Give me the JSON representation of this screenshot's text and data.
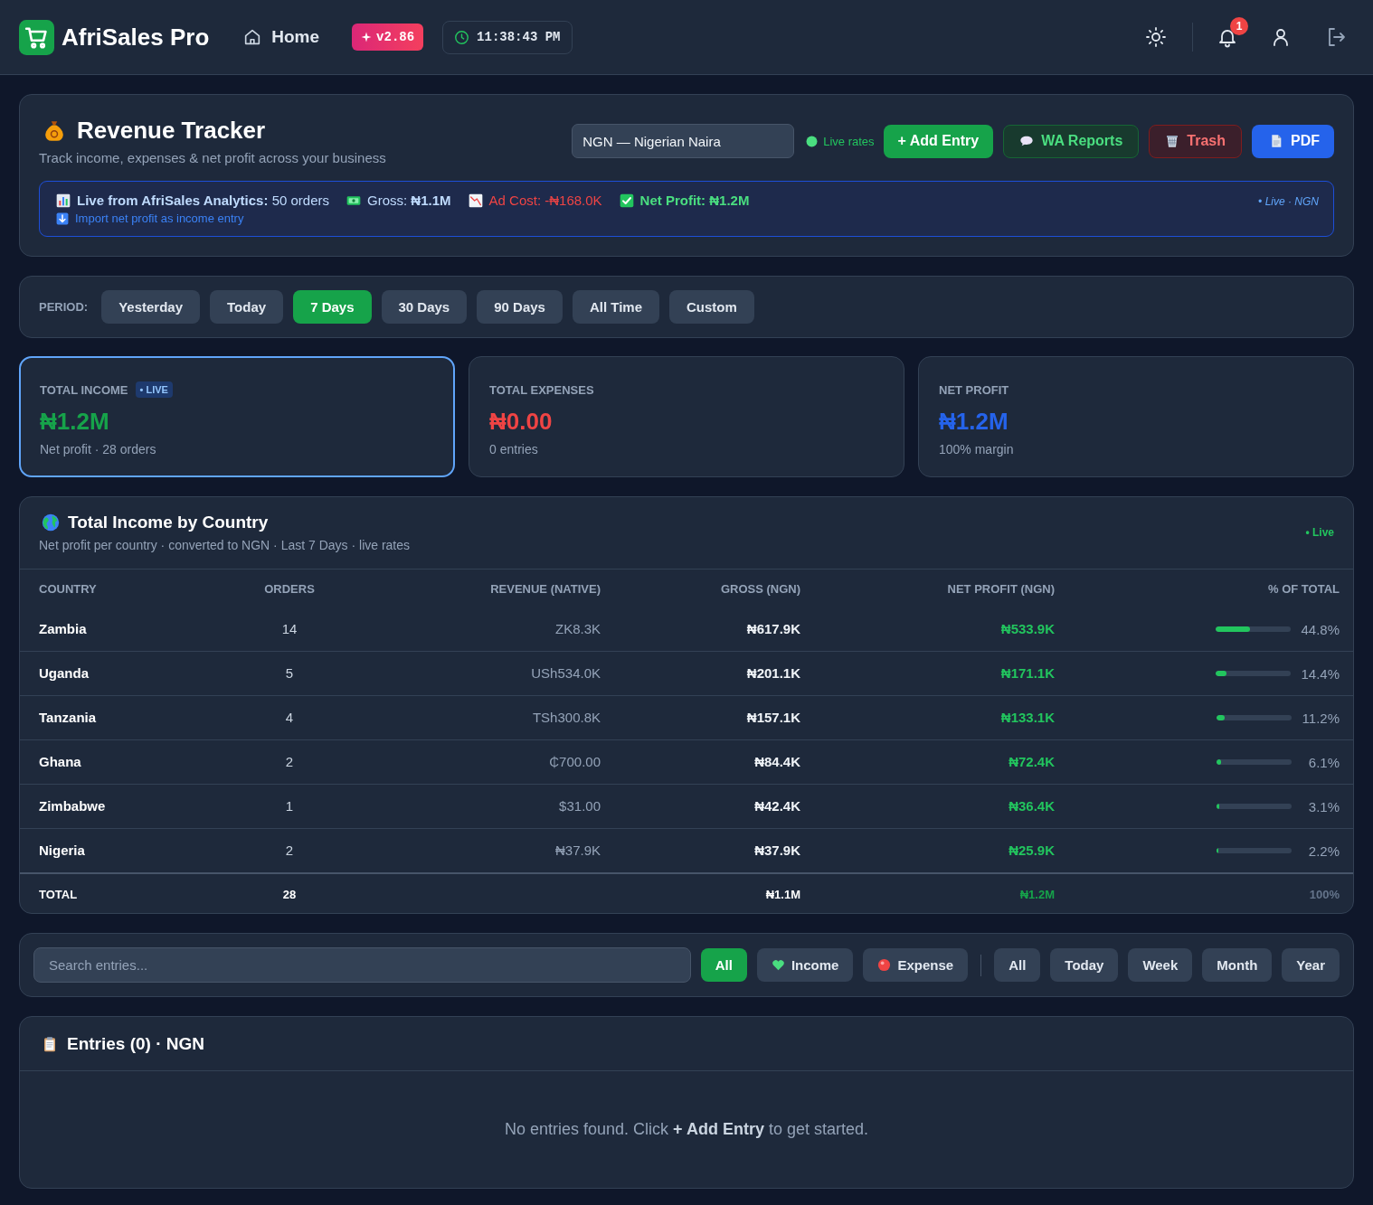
{
  "header": {
    "brand": "AfriSales Pro",
    "nav_link": "Home",
    "version": "v2.86",
    "clock": "11:38:43 PM",
    "notification_count": "1"
  },
  "tracker": {
    "title": "Revenue Tracker",
    "subtitle": "Track income, expenses & net profit across your business",
    "currency": {
      "value": "NGN — Nigerian Naira"
    },
    "rates_status": "Live rates",
    "buttons": [
      {
        "kind": "add",
        "label": "+ Add Entry"
      },
      {
        "kind": "whatsapp",
        "label": "WA Reports"
      },
      {
        "kind": "trash",
        "label": "Trash"
      },
      {
        "kind": "pdf",
        "label": "PDF"
      }
    ],
    "analytics": {
      "items": [
        {
          "kind": "source",
          "text": "**Live from AfriSales Analytics:** 50 orders"
        },
        {
          "kind": "gross",
          "text": "Gross: **₦1.1M**"
        },
        {
          "kind": "ad_cost",
          "text": "Ad Cost: -₦168.0K"
        },
        {
          "kind": "net_profit",
          "text": "**Net Profit: ₦1.2M**"
        }
      ],
      "status": "• Live · NGN",
      "import_link": "Import net profit as income entry"
    }
  },
  "period": {
    "label": "PERIOD:",
    "options": [
      {
        "label": "Yesterday",
        "selected": false
      },
      {
        "label": "Today",
        "selected": false
      },
      {
        "label": "7 Days",
        "selected": true
      },
      {
        "label": "30 Days",
        "selected": false
      },
      {
        "label": "90 Days",
        "selected": false
      },
      {
        "label": "All Time",
        "selected": false
      },
      {
        "label": "Custom",
        "selected": false
      }
    ]
  },
  "stats": [
    {
      "kind": "income",
      "title": "TOTAL INCOME",
      "badge": "• LIVE",
      "value": "₦1.2M",
      "note": "Net profit · 28 orders",
      "selected": true
    },
    {
      "kind": "expense",
      "title": "TOTAL EXPENSES",
      "value": "₦0.00",
      "note": "0 entries",
      "selected": false
    },
    {
      "kind": "profit",
      "title": "NET PROFIT",
      "value": "₦1.2M",
      "note": "100% margin",
      "selected": false
    }
  ],
  "country_table": {
    "title": "Total Income by Country",
    "subtitle": "Net profit per country · converted to NGN · Last 7 Days · live rates",
    "status": "• Live",
    "columns": [
      "COUNTRY",
      "ORDERS",
      "REVENUE (NATIVE)",
      "GROSS (NGN)",
      "NET PROFIT (NGN)",
      "% OF TOTAL"
    ],
    "rows": [
      {
        "country": "Zambia",
        "orders": "14",
        "revenue": "ZK8.3K",
        "gross": "₦617.9K",
        "net": "₦533.9K",
        "share": "44.8%",
        "level": 0.448
      },
      {
        "country": "Uganda",
        "orders": "5",
        "revenue": "USh534.0K",
        "gross": "₦201.1K",
        "net": "₦171.1K",
        "share": "14.4%",
        "level": 0.144
      },
      {
        "country": "Tanzania",
        "orders": "4",
        "revenue": "TSh300.8K",
        "gross": "₦157.1K",
        "net": "₦133.1K",
        "share": "11.2%",
        "level": 0.112
      },
      {
        "country": "Ghana",
        "orders": "2",
        "revenue": "₵700.00",
        "gross": "₦84.4K",
        "net": "₦72.4K",
        "share": "6.1%",
        "level": 0.061
      },
      {
        "country": "Zimbabwe",
        "orders": "1",
        "revenue": "$31.00",
        "gross": "₦42.4K",
        "net": "₦36.4K",
        "share": "3.1%",
        "level": 0.031
      },
      {
        "country": "Nigeria",
        "orders": "2",
        "revenue": "₦37.9K",
        "gross": "₦37.9K",
        "net": "₦25.9K",
        "share": "2.2%",
        "level": 0.022
      }
    ],
    "total": {
      "label": "TOTAL",
      "orders": "28",
      "gross": "₦1.1M",
      "net": "₦1.2M",
      "share": "100%"
    }
  },
  "entry_filters": {
    "search": {
      "placeholder": "Search entries..."
    },
    "type_filters": [
      {
        "kind": "all",
        "label": "All",
        "selected": true
      },
      {
        "kind": "income",
        "label": "Income",
        "selected": false
      },
      {
        "kind": "expense",
        "label": "Expense",
        "selected": false
      }
    ],
    "range_filters": [
      {
        "label": "All",
        "selected": false
      },
      {
        "label": "Today",
        "selected": false
      },
      {
        "label": "Week",
        "selected": false
      },
      {
        "label": "Month",
        "selected": false
      },
      {
        "label": "Year",
        "selected": false
      }
    ]
  },
  "entries": {
    "title": "Entries (0) · NGN",
    "empty_message": "No entries found. Click **+ Add Entry** to get started."
  }
}
